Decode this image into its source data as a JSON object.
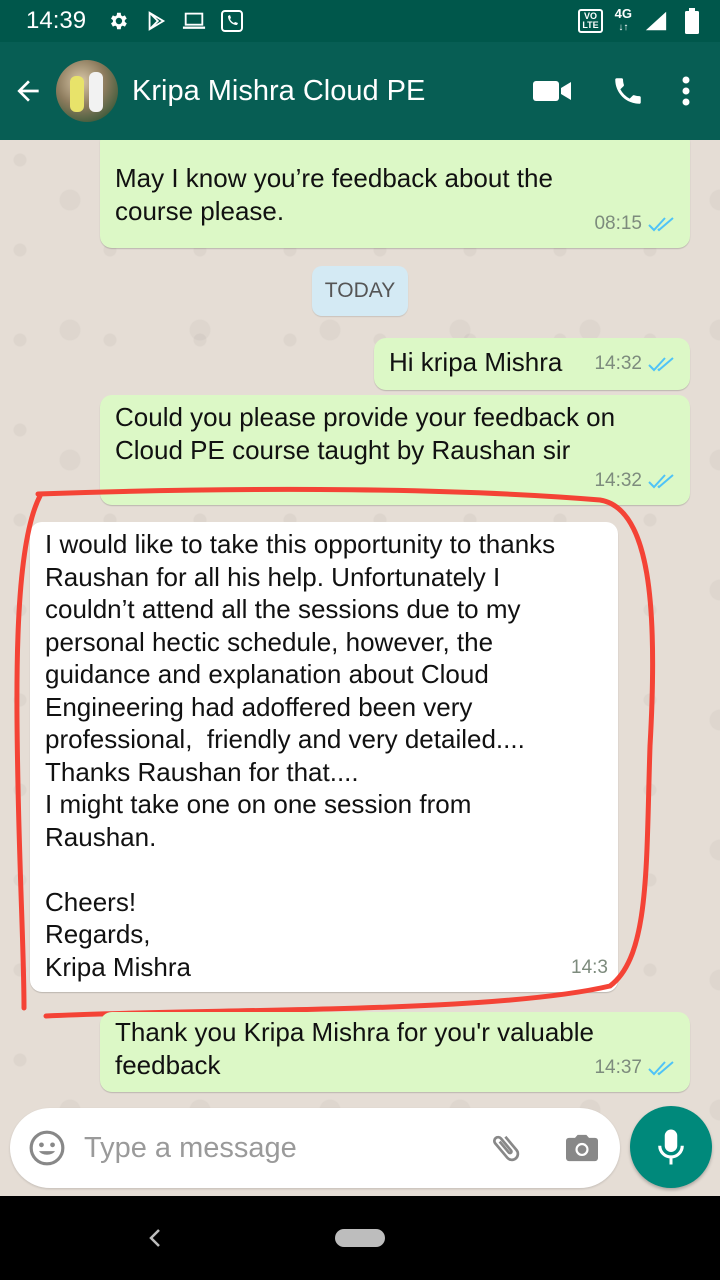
{
  "status_bar": {
    "time": "14:39",
    "left_icons": [
      "settings-icon",
      "play-store-icon",
      "laptop-icon",
      "phone-vibrate-icon"
    ],
    "volte_label": "VO\nLTE",
    "network_label": "4G",
    "right_icons": [
      "volte-icon",
      "network-4g-icon",
      "signal-icon",
      "battery-icon"
    ]
  },
  "header": {
    "contact_name": "Kripa Mishra Cloud PE",
    "icons": [
      "back-arrow-icon",
      "avatar",
      "video-call-icon",
      "phone-call-icon",
      "more-menu-icon"
    ]
  },
  "chat": {
    "date_separator": "TODAY",
    "messages": [
      {
        "direction": "out",
        "text": "May I know you’re feedback about the\ncourse please.",
        "time": "08:15",
        "read": true
      },
      {
        "direction": "out",
        "text": "Hi kripa Mishra",
        "time": "14:32",
        "read": true
      },
      {
        "direction": "out",
        "text": "Could you please provide your feedback on\nCloud PE course taught by Raushan sir",
        "time": "14:32",
        "read": true
      },
      {
        "direction": "in",
        "text": "I would like to take this opportunity to thanks\nRaushan for all his help. Unfortunately I\ncouldn’t attend all the sessions due to my\npersonal hectic schedule, however, the\nguidance and explanation about Cloud\nEngineering had adoffered been very\nprofessional,  friendly and very detailed....\nThanks Raushan for that....\nI might take one on one session from\nRaushan.\n\nCheers!\nRegards,\nKripa Mishra",
        "time": "14:3",
        "highlighted": true
      },
      {
        "direction": "out",
        "text": "Thank you Kripa Mishra for you'r valuable\nfeedback",
        "time": "14:37",
        "read": true
      }
    ]
  },
  "composer": {
    "placeholder": "Type a message",
    "value": ""
  },
  "colors": {
    "header": "#075e54",
    "status_bar": "#00574b",
    "outgoing_bubble": "#dcf8c6",
    "incoming_bubble": "#ffffff",
    "read_ticks": "#4fc3f7",
    "mic_button": "#00897b",
    "highlight_outline": "#f44336"
  }
}
